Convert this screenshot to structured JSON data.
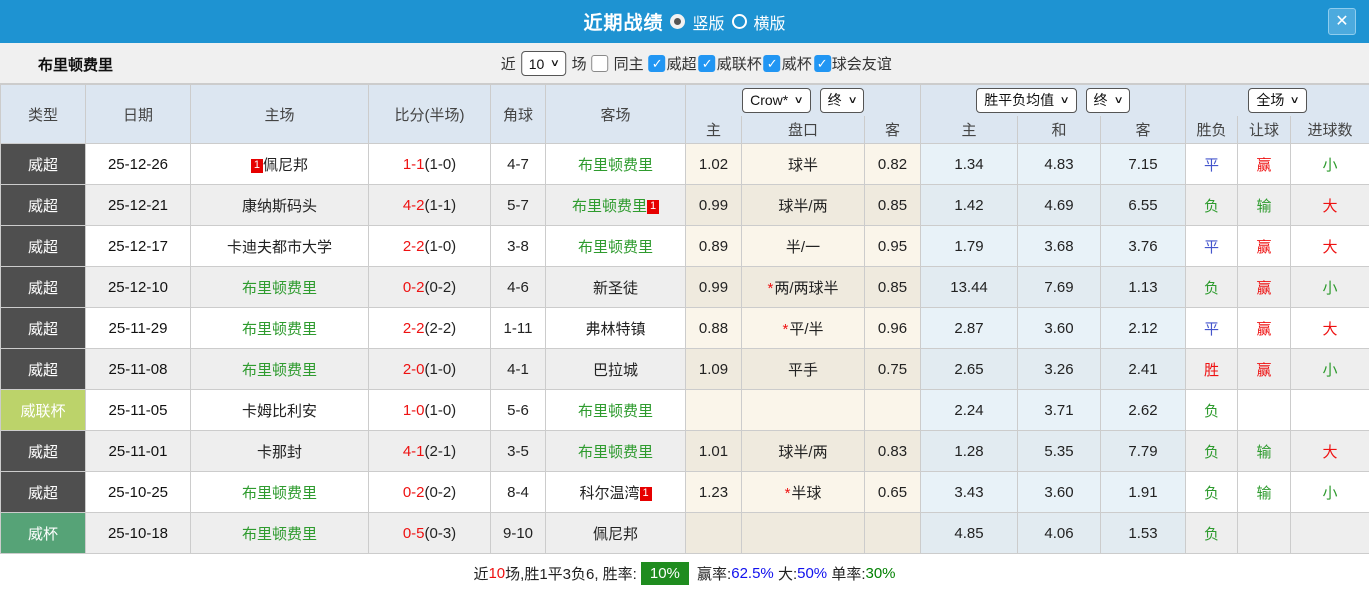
{
  "titlebar": {
    "title": "近期战绩",
    "vertical_label": "竖版",
    "horizontal_label": "横版",
    "close_icon": "✕"
  },
  "filterbar": {
    "team": "布里顿费里",
    "near_label": "近",
    "count_value": "10",
    "games_label": "场",
    "same_home_label": "同主",
    "leagues": [
      "威超",
      "威联杯",
      "威杯",
      "球会友谊"
    ]
  },
  "table": {
    "headers": {
      "type": "类型",
      "date": "日期",
      "home": "主场",
      "score": "比分(半场)",
      "corner": "角球",
      "away": "客场",
      "sub": [
        "主",
        "盘口",
        "客",
        "主",
        "和",
        "客",
        "胜负",
        "让球",
        "进球数"
      ]
    },
    "selects": {
      "company": "Crow*",
      "company_time": "终",
      "avg": "胜平负均值",
      "avg_time": "终",
      "scope": "全场"
    },
    "rows": [
      {
        "type": "威超",
        "type_style": "t-dark",
        "date": "25-12-26",
        "home": {
          "name": "佩尼邦",
          "green": false,
          "card": "1",
          "card_pos": "before"
        },
        "score_ft": "1-1",
        "score_ht": "(1-0)",
        "corner": "4-7",
        "away": {
          "name": "布里顿费里",
          "green": true
        },
        "odds_home": "1.02",
        "handicap": "球半",
        "handicap_star": false,
        "odds_away": "0.82",
        "avg_home": "1.34",
        "avg_draw": "4.83",
        "avg_away": "7.15",
        "outcome": {
          "t": "平",
          "c": "blue"
        },
        "handicap_res": {
          "t": "赢",
          "c": "red"
        },
        "goals_res": {
          "t": "小",
          "c": "green"
        }
      },
      {
        "type": "威超",
        "type_style": "t-dark",
        "date": "25-12-21",
        "home": {
          "name": "康纳斯码头",
          "green": false
        },
        "score_ft": "4-2",
        "score_ht": "(1-1)",
        "corner": "5-7",
        "away": {
          "name": "布里顿费里",
          "green": true,
          "card": "1",
          "card_pos": "after"
        },
        "odds_home": "0.99",
        "handicap": "球半/两",
        "handicap_star": false,
        "odds_away": "0.85",
        "avg_home": "1.42",
        "avg_draw": "4.69",
        "avg_away": "6.55",
        "outcome": {
          "t": "负",
          "c": "green"
        },
        "handicap_res": {
          "t": "输",
          "c": "green"
        },
        "goals_res": {
          "t": "大",
          "c": "red"
        }
      },
      {
        "type": "威超",
        "type_style": "t-dark",
        "date": "25-12-17",
        "home": {
          "name": "卡迪夫都市大学",
          "green": false
        },
        "score_ft": "2-2",
        "score_ht": "(1-0)",
        "corner": "3-8",
        "away": {
          "name": "布里顿费里",
          "green": true
        },
        "odds_home": "0.89",
        "handicap": "半/一",
        "handicap_star": false,
        "odds_away": "0.95",
        "avg_home": "1.79",
        "avg_draw": "3.68",
        "avg_away": "3.76",
        "outcome": {
          "t": "平",
          "c": "blue"
        },
        "handicap_res": {
          "t": "赢",
          "c": "red"
        },
        "goals_res": {
          "t": "大",
          "c": "red"
        }
      },
      {
        "type": "威超",
        "type_style": "t-dark",
        "date": "25-12-10",
        "home": {
          "name": "布里顿费里",
          "green": true
        },
        "score_ft": "0-2",
        "score_ht": "(0-2)",
        "corner": "4-6",
        "away": {
          "name": "新圣徒",
          "green": false
        },
        "odds_home": "0.99",
        "handicap": "两/两球半",
        "handicap_star": true,
        "odds_away": "0.85",
        "avg_home": "13.44",
        "avg_draw": "7.69",
        "avg_away": "1.13",
        "outcome": {
          "t": "负",
          "c": "green"
        },
        "handicap_res": {
          "t": "赢",
          "c": "red"
        },
        "goals_res": {
          "t": "小",
          "c": "green"
        }
      },
      {
        "type": "威超",
        "type_style": "t-dark",
        "date": "25-11-29",
        "home": {
          "name": "布里顿费里",
          "green": true
        },
        "score_ft": "2-2",
        "score_ht": "(2-2)",
        "corner": "1-11",
        "away": {
          "name": "弗林特镇",
          "green": false
        },
        "odds_home": "0.88",
        "handicap": "平/半",
        "handicap_star": true,
        "odds_away": "0.96",
        "avg_home": "2.87",
        "avg_draw": "3.60",
        "avg_away": "2.12",
        "outcome": {
          "t": "平",
          "c": "blue"
        },
        "handicap_res": {
          "t": "赢",
          "c": "red"
        },
        "goals_res": {
          "t": "大",
          "c": "red"
        }
      },
      {
        "type": "威超",
        "type_style": "t-dark",
        "date": "25-11-08",
        "home": {
          "name": "布里顿费里",
          "green": true
        },
        "score_ft": "2-0",
        "score_ht": "(1-0)",
        "corner": "4-1",
        "away": {
          "name": "巴拉城",
          "green": false
        },
        "odds_home": "1.09",
        "handicap": "平手",
        "handicap_star": false,
        "odds_away": "0.75",
        "avg_home": "2.65",
        "avg_draw": "3.26",
        "avg_away": "2.41",
        "outcome": {
          "t": "胜",
          "c": "red"
        },
        "handicap_res": {
          "t": "赢",
          "c": "red"
        },
        "goals_res": {
          "t": "小",
          "c": "green"
        }
      },
      {
        "type": "威联杯",
        "type_style": "t-lime",
        "date": "25-11-05",
        "home": {
          "name": "卡姆比利安",
          "green": false
        },
        "score_ft": "1-0",
        "score_ht": "(1-0)",
        "corner": "5-6",
        "away": {
          "name": "布里顿费里",
          "green": true
        },
        "odds_home": "",
        "handicap": "",
        "handicap_star": false,
        "odds_away": "",
        "avg_home": "2.24",
        "avg_draw": "3.71",
        "avg_away": "2.62",
        "outcome": {
          "t": "负",
          "c": "green"
        },
        "handicap_res": {
          "t": "",
          "c": "none"
        },
        "goals_res": {
          "t": "",
          "c": "none"
        }
      },
      {
        "type": "威超",
        "type_style": "t-dark",
        "date": "25-11-01",
        "home": {
          "name": "卡那封",
          "green": false
        },
        "score_ft": "4-1",
        "score_ht": "(2-1)",
        "corner": "3-5",
        "away": {
          "name": "布里顿费里",
          "green": true
        },
        "odds_home": "1.01",
        "handicap": "球半/两",
        "handicap_star": false,
        "odds_away": "0.83",
        "avg_home": "1.28",
        "avg_draw": "5.35",
        "avg_away": "7.79",
        "outcome": {
          "t": "负",
          "c": "green"
        },
        "handicap_res": {
          "t": "输",
          "c": "green"
        },
        "goals_res": {
          "t": "大",
          "c": "red"
        }
      },
      {
        "type": "威超",
        "type_style": "t-dark",
        "date": "25-10-25",
        "home": {
          "name": "布里顿费里",
          "green": true
        },
        "score_ft": "0-2",
        "score_ht": "(0-2)",
        "corner": "8-4",
        "away": {
          "name": "科尔温湾",
          "green": false,
          "card": "1",
          "card_pos": "after"
        },
        "odds_home": "1.23",
        "handicap": "半球",
        "handicap_star": true,
        "odds_away": "0.65",
        "avg_home": "3.43",
        "avg_draw": "3.60",
        "avg_away": "1.91",
        "outcome": {
          "t": "负",
          "c": "green"
        },
        "handicap_res": {
          "t": "输",
          "c": "green"
        },
        "goals_res": {
          "t": "小",
          "c": "green"
        }
      },
      {
        "type": "威杯",
        "type_style": "t-green",
        "date": "25-10-18",
        "home": {
          "name": "布里顿费里",
          "green": true
        },
        "score_ft": "0-5",
        "score_ht": "(0-3)",
        "corner": "9-10",
        "away": {
          "name": "佩尼邦",
          "green": false
        },
        "odds_home": "",
        "handicap": "",
        "handicap_star": false,
        "odds_away": "",
        "avg_home": "4.85",
        "avg_draw": "4.06",
        "avg_away": "1.53",
        "outcome": {
          "t": "负",
          "c": "green"
        },
        "handicap_res": {
          "t": "",
          "c": "none"
        },
        "goals_res": {
          "t": "",
          "c": "none"
        }
      }
    ]
  },
  "summary": {
    "parts": [
      {
        "text": "近",
        "cls": "k"
      },
      {
        "text": "10",
        "cls": "red"
      },
      {
        "text": "场,胜1平3负6, 胜率:",
        "cls": "k"
      },
      {
        "text": "10%",
        "cls": "badge"
      },
      {
        "text": " 赢率:",
        "cls": "k"
      },
      {
        "text": "62.5%",
        "cls": "blue"
      },
      {
        "text": " 大:",
        "cls": "k"
      },
      {
        "text": "50%",
        "cls": "blue"
      },
      {
        "text": " 单率:",
        "cls": "k"
      },
      {
        "text": "30%",
        "cls": "green"
      }
    ]
  }
}
